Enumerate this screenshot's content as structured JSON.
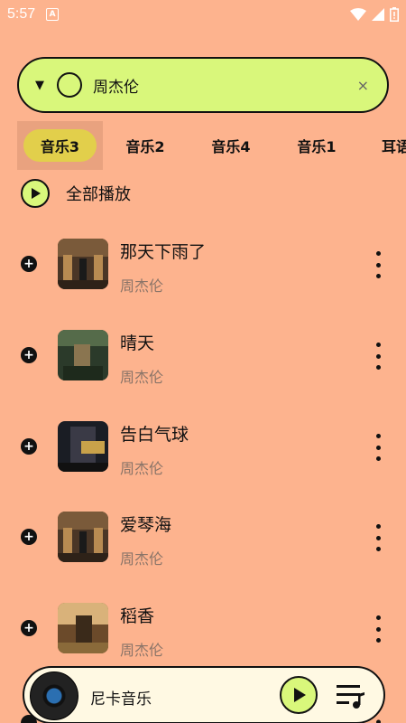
{
  "status_bar": {
    "time": "5:57",
    "notif_glyph": "A"
  },
  "search": {
    "query": "周杰伦",
    "clear_glyph": "×",
    "dropdown_glyph": "▼"
  },
  "tabs": [
    {
      "label": "音乐3",
      "active": true
    },
    {
      "label": "音乐2",
      "active": false
    },
    {
      "label": "音乐4",
      "active": false
    },
    {
      "label": "音乐1",
      "active": false
    },
    {
      "label": "耳语",
      "active": false
    }
  ],
  "play_all": {
    "label": "全部播放"
  },
  "songs": [
    {
      "title": "那天下雨了",
      "artist": "周杰伦"
    },
    {
      "title": "晴天",
      "artist": "周杰伦"
    },
    {
      "title": "告白气球",
      "artist": "周杰伦"
    },
    {
      "title": "爱琴海",
      "artist": "周杰伦"
    },
    {
      "title": "稻香",
      "artist": "周杰伦"
    }
  ],
  "player": {
    "title": "尼卡音乐"
  },
  "colors": {
    "background": "#FDB38E",
    "accent": "#D9F77B",
    "active_tab": "#E2CF4B"
  }
}
